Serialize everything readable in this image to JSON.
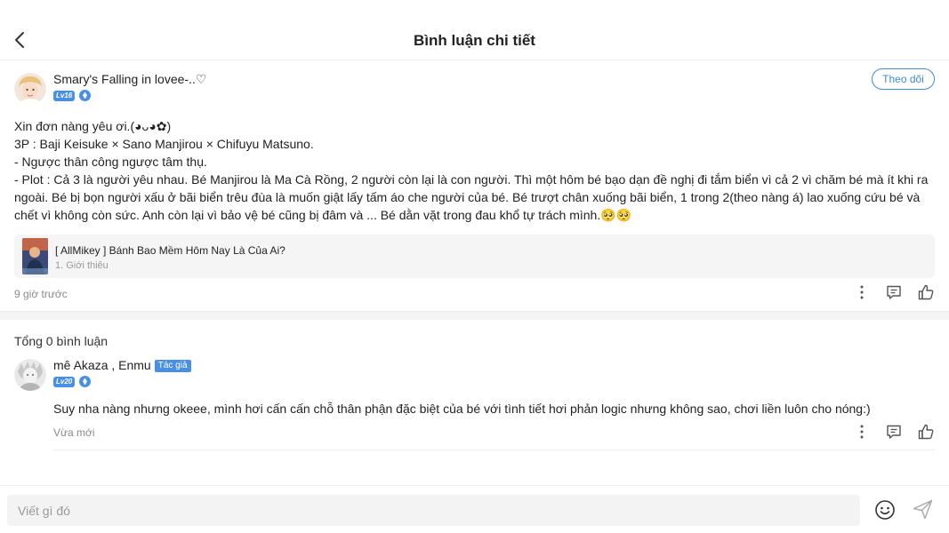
{
  "header": {
    "title": "Bình luận chi tiết"
  },
  "post": {
    "author": {
      "name": "Smary's Falling in lovee-..♡",
      "level": "Lv16"
    },
    "follow_label": "Theo dõi",
    "body_lines": [
      "Xin đơn nàng yêu ơi.(◕ᴗ◕✿)",
      "3P : Baji Keisuke × Sano Manjirou × Chifuyu Matsuno.",
      "- Ngược thân công ngược tâm thụ.",
      "- Plot : Cả 3 là người yêu nhau. Bé Manjirou là Ma Cà Rồng, 2 người còn lại là con người. Thì một hôm bé bạo dạn đề nghị đi tắm biển vì cả 2 vì chăm bé mà ít khi ra ngoài. Bé bị bọn người xấu ở bãi biển trêu đùa là muốn giật lấy tấm áo che người của bé. Bé trượt chân xuống bãi biển, 1 trong 2(theo nàng á) lao xuống cứu bé và chết vì không còn sức. Anh còn lại vì bảo vệ bé cũng bị đâm và ... Bé dằn vặt trong đau khổ tự trách mình.🥺🥺"
    ],
    "story": {
      "title": "[ AllMikey ] Bánh Bao Mềm Hôm Nay Là Của Ai?",
      "chapter": "1. Giới thiêu"
    },
    "time": "9 giờ trước",
    "icons": [
      "more-icon",
      "reply-icon",
      "like-icon"
    ]
  },
  "comments_section": {
    "count_label": "Tổng 0 bình luận"
  },
  "comment": {
    "author": {
      "name": "mê Akaza , Enmu",
      "tag": "Tác giả",
      "level": "Lv20"
    },
    "text": "Suy nha nàng nhưng okeee, mình hơi cấn cấn chỗ thân phận đặc biệt của bé với tình tiết hơi phản logic nhưng không sao, chơi liền luôn cho nóng:)",
    "time": "Vừa mới"
  },
  "composer": {
    "placeholder": "Viết gì đó",
    "icons": [
      "emoji-icon",
      "send-icon"
    ]
  },
  "colors": {
    "accent": "#3f8bd6",
    "level_badge": "#4a90e2",
    "muted_text": "#8a8a8a",
    "card_bg": "#f5f5f5"
  }
}
